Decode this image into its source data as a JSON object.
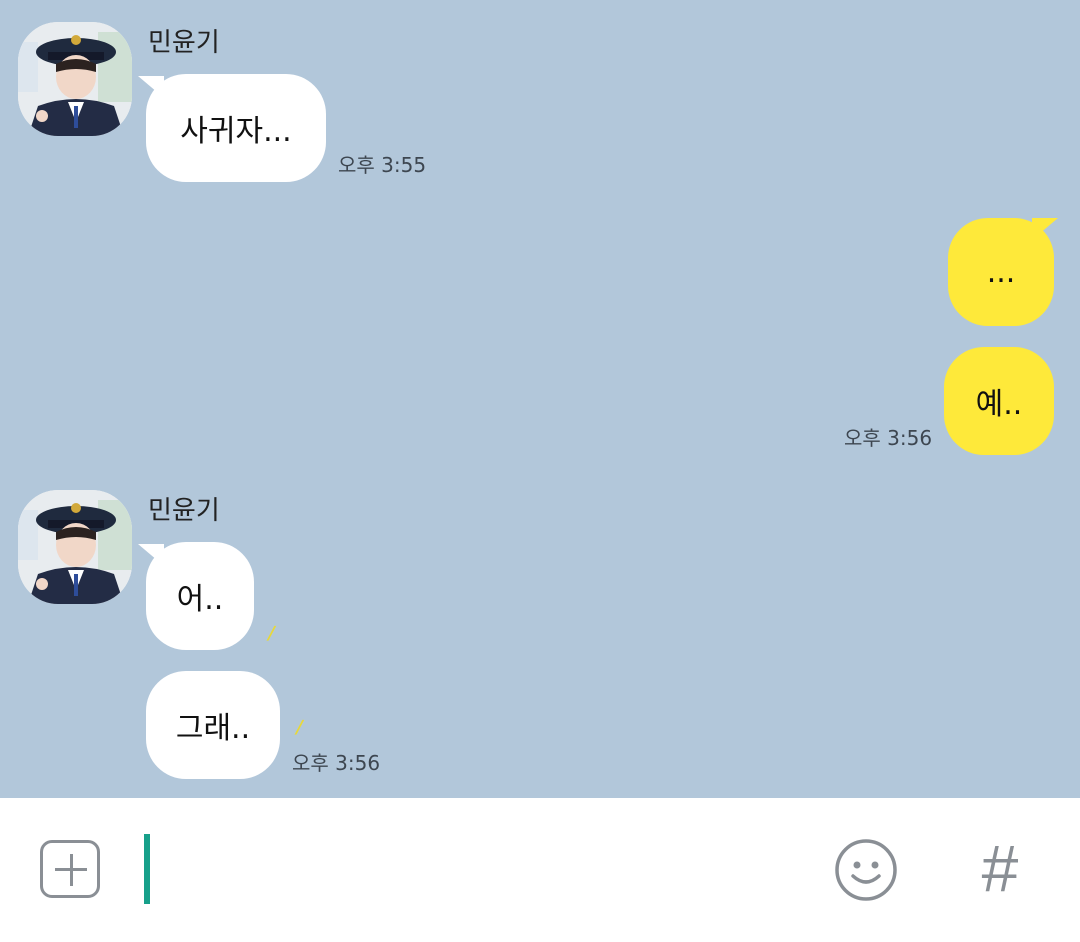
{
  "chat": {
    "contact_name": "민윤기",
    "group1": {
      "sender": "민윤기",
      "messages": [
        "사귀자..."
      ],
      "time": "오후 3:55"
    },
    "group2": {
      "messages": [
        "...",
        "예.."
      ],
      "time": "오후 3:56"
    },
    "group3": {
      "sender": "민윤기",
      "messages": [
        "어..",
        "그래.."
      ],
      "time": "오후 3:56"
    }
  },
  "input_bar": {
    "plus_icon": "plus-icon",
    "emoji_icon": "emoji-icon",
    "hash_label": "#"
  },
  "colors": {
    "background": "#b2c7da",
    "incoming_bubble": "#ffffff",
    "outgoing_bubble": "#fee93a",
    "cursor": "#17a08a"
  }
}
